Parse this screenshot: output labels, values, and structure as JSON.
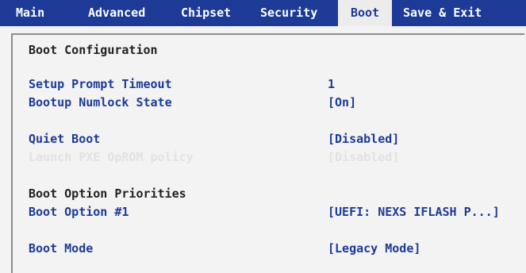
{
  "tabs": [
    {
      "label": "Main"
    },
    {
      "label": "Advanced"
    },
    {
      "label": "Chipset"
    },
    {
      "label": "Security"
    },
    {
      "label": "Boot",
      "active": true
    },
    {
      "label": "Save & Exit"
    }
  ],
  "section_title": "Boot Configuration",
  "settings": {
    "setup_prompt_timeout": {
      "label": "Setup Prompt Timeout",
      "value": "1"
    },
    "bootup_numlock_state": {
      "label": "Bootup Numlock State",
      "value": "[On]"
    },
    "quiet_boot": {
      "label": "Quiet Boot",
      "value": "[Disabled]"
    },
    "launch_pxe_oprom_policy": {
      "label": "Launch PXE OpROM policy",
      "value": "[Disabled]",
      "state": "disabled"
    },
    "boot_option_1": {
      "label": "Boot Option #1",
      "value": "[UEFI: NEXS IFLASH P...]"
    },
    "boot_mode": {
      "label": "Boot Mode",
      "value": "[Legacy Mode]"
    }
  },
  "boot_option_priorities_heading": "Boot Option Priorities",
  "colors": {
    "tab_bar": "#1d3a97",
    "active_tab_bg": "#ececec",
    "label_text": "#1d3a97",
    "disabled_text": "#e2e2e2",
    "panel_bg": "#f3f3f3"
  }
}
